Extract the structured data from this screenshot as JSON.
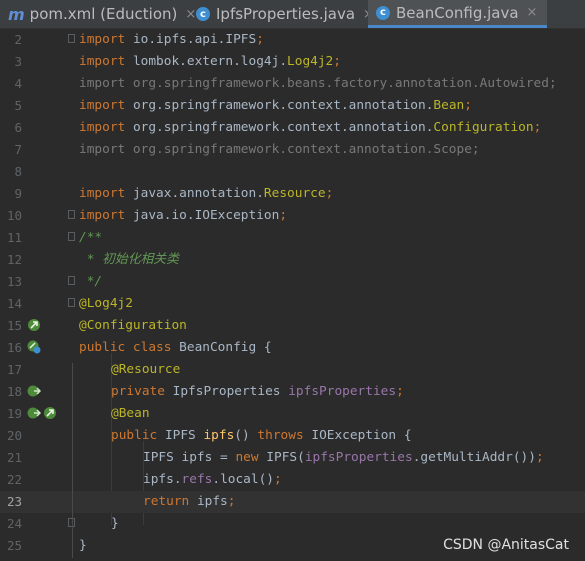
{
  "tabs": [
    {
      "label": "pom.xml (Eduction)",
      "icon": "maven-icon",
      "active": false
    },
    {
      "label": "IpfsProperties.java",
      "icon": "class-icon",
      "active": false
    },
    {
      "label": "BeanConfig.java",
      "icon": "class-icon",
      "active": true
    }
  ],
  "tab_icon_text": {
    "maven": "m",
    "class": "c",
    "close": "×"
  },
  "line_numbers": [
    "2",
    "3",
    "4",
    "5",
    "6",
    "7",
    "8",
    "9",
    "10",
    "11",
    "12",
    "13",
    "14",
    "15",
    "16",
    "17",
    "18",
    "19",
    "20",
    "21",
    "22",
    "23",
    "24",
    "25"
  ],
  "code": {
    "l2": {
      "kw": "import",
      "rest": " io.ipfs.api.IPFS",
      "semi": ";"
    },
    "l3": {
      "kw": "import",
      "rest": " lombok.extern.log4j.",
      "type": "Log4j2",
      "semi": ";"
    },
    "l4": {
      "text": "import org.springframework.beans.factory.annotation.Autowired;"
    },
    "l5": {
      "kw": "import",
      "rest": " org.springframework.context.annotation.",
      "type": "Bean",
      "semi": ";"
    },
    "l6": {
      "kw": "import",
      "rest": " org.springframework.context.annotation.",
      "type": "Configuration",
      "semi": ";"
    },
    "l7": {
      "text": "import org.springframework.context.annotation.Scope;"
    },
    "l9": {
      "kw": "import",
      "rest": " javax.annotation.",
      "type": "Resource",
      "semi": ";"
    },
    "l10": {
      "kw": "import",
      "rest": " java.io.IOException",
      "semi": ";"
    },
    "l11": {
      "comment": "/**"
    },
    "l12": {
      "comment": " * 初始化相关类"
    },
    "l13": {
      "comment": " */"
    },
    "l14": {
      "annotation": "@Log4j2"
    },
    "l15": {
      "annotation": "@Configuration"
    },
    "l16": {
      "kw": "public class",
      "rest": " BeanConfig {"
    },
    "l17": {
      "annotation": "@Resource"
    },
    "l18": {
      "kw": "private",
      "rest": " IpfsProperties ",
      "field": "ipfsProperties",
      "semi": ";"
    },
    "l19": {
      "annotation": "@Bean"
    },
    "l20": {
      "kw": "public",
      "rest": " IPFS ",
      "method": "ipfs",
      "rest2": "() ",
      "kw2": "throws",
      "rest3": " IOException {"
    },
    "l21": {
      "a": "IPFS ipfs = ",
      "kw": "new",
      "b": " IPFS(",
      "field": "ipfsProperties",
      "c": ".getMultiAddr())",
      "semi": ";"
    },
    "l22": {
      "a": "ipfs.",
      "field": "refs",
      "b": ".local()",
      "semi": ";"
    },
    "l23": {
      "kw": "return",
      "rest": " ipfs",
      "semi": ";"
    },
    "l24": {
      "text": "}"
    },
    "l25": {
      "text": "}"
    }
  },
  "watermark": "CSDN @AnitasCat",
  "colors": {
    "background": "#2b2b2b",
    "keyword": "#cc7832",
    "annotation": "#bbb529",
    "field": "#9876aa",
    "method": "#ffc66d",
    "comment": "#629755"
  }
}
